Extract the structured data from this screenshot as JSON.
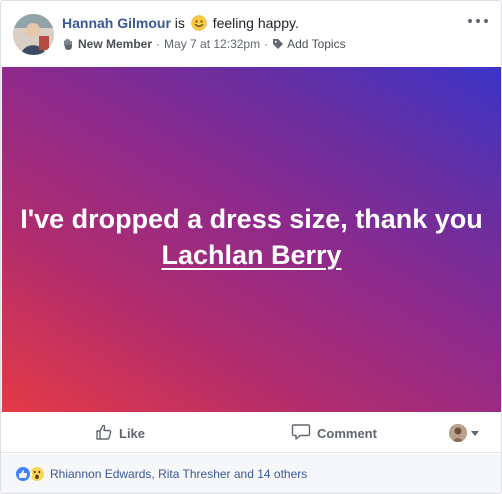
{
  "post": {
    "author": "Hannah Gilmour",
    "is_word": "is",
    "feeling_text": "feeling happy.",
    "badge": "New Member",
    "date": "May 7 at 12:32pm",
    "separator": "·",
    "topics_label": "Add Topics",
    "banner_text_before": "I've dropped a dress size, thank you ",
    "banner_mention": "Lachlan Berry",
    "gradient_colors": [
      "#e53a45",
      "#8e2a8c",
      "#3b34c8"
    ]
  },
  "actions": {
    "like_label": "Like",
    "comment_label": "Comment"
  },
  "reactions": {
    "summary": "Rhiannon Edwards, Rita Thresher and 14 others",
    "icons": [
      "like-icon",
      "wow-icon"
    ]
  },
  "colors": {
    "link": "#385898",
    "muted": "#616770",
    "like_blue": "#4080ff"
  }
}
